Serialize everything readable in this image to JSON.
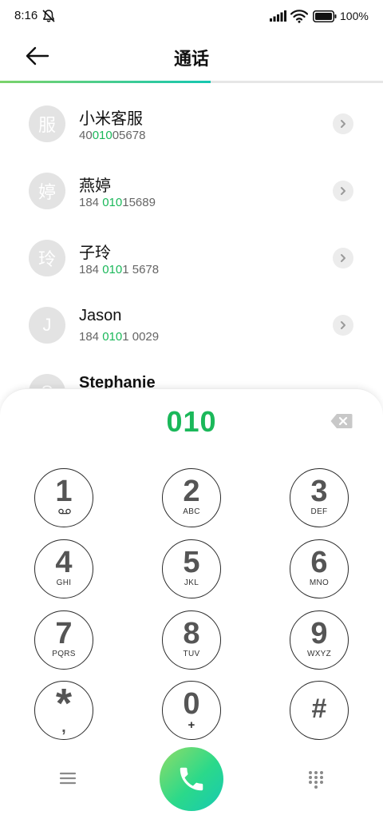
{
  "status_bar": {
    "time": "8:16",
    "battery": "100%",
    "icons": [
      "bell-muted-icon",
      "signal-icon",
      "wifi-icon",
      "battery-icon"
    ]
  },
  "header": {
    "title": "通话",
    "back_icon": "arrow-left-icon",
    "progress_fraction": 0.55
  },
  "contacts": [
    {
      "avatar": "服",
      "name": "小米客服",
      "number_parts": [
        "40",
        "010",
        "05678"
      ]
    },
    {
      "avatar": "婷",
      "name": "燕婷",
      "number_parts": [
        "184 ",
        "010",
        "15689"
      ]
    },
    {
      "avatar": "玲",
      "name": "子玲",
      "number_parts": [
        "184 ",
        "010",
        "1 5678"
      ]
    },
    {
      "avatar": "J",
      "name": "Jason",
      "number_parts": [
        "184 ",
        "010",
        "1 0029"
      ]
    },
    {
      "avatar": "S",
      "name": "Stephanie",
      "number_parts": [
        "",
        "",
        ""
      ]
    }
  ],
  "dialer": {
    "input": "010",
    "keys": [
      {
        "digit": "1",
        "letters": "voicemail"
      },
      {
        "digit": "2",
        "letters": "ABC"
      },
      {
        "digit": "3",
        "letters": "DEF"
      },
      {
        "digit": "4",
        "letters": "GHI"
      },
      {
        "digit": "5",
        "letters": "JKL"
      },
      {
        "digit": "6",
        "letters": "MNO"
      },
      {
        "digit": "7",
        "letters": "PQRS"
      },
      {
        "digit": "8",
        "letters": "TUV"
      },
      {
        "digit": "9",
        "letters": "WXYZ"
      },
      {
        "digit": "*",
        "letters": ","
      },
      {
        "digit": "0",
        "letters": "+"
      },
      {
        "digit": "#",
        "letters": ""
      }
    ]
  },
  "colors": {
    "accent_green": "#1bb85a",
    "call_gradient_start": "#8fdc67",
    "call_gradient_end": "#17c9b2"
  }
}
